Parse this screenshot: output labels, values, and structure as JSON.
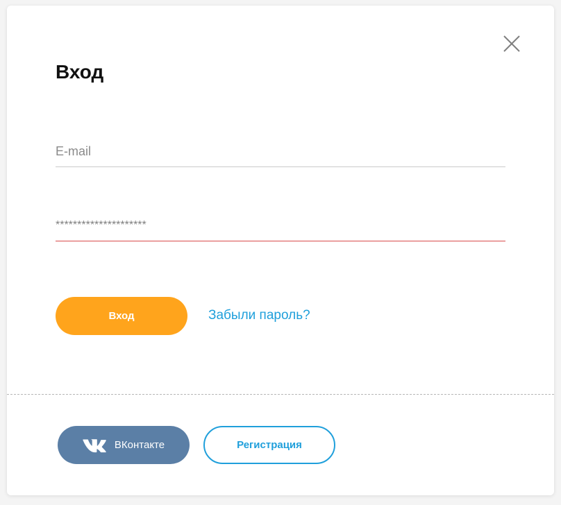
{
  "modal": {
    "title": "Вход",
    "close_icon": "close-icon"
  },
  "form": {
    "email_placeholder": "E-mail",
    "email_value": "",
    "password_value": "*********************",
    "password_underline_color": "#d94b4b"
  },
  "actions": {
    "login_label": "Вход",
    "login_color": "#ffa41c",
    "forgot_label": "Забыли пароль?",
    "link_color": "#1f9fdb"
  },
  "footer": {
    "vk_label": "ВКонтакте",
    "vk_icon": "vk-icon",
    "vk_color": "#5b7fa6",
    "register_label": "Регистрация"
  }
}
